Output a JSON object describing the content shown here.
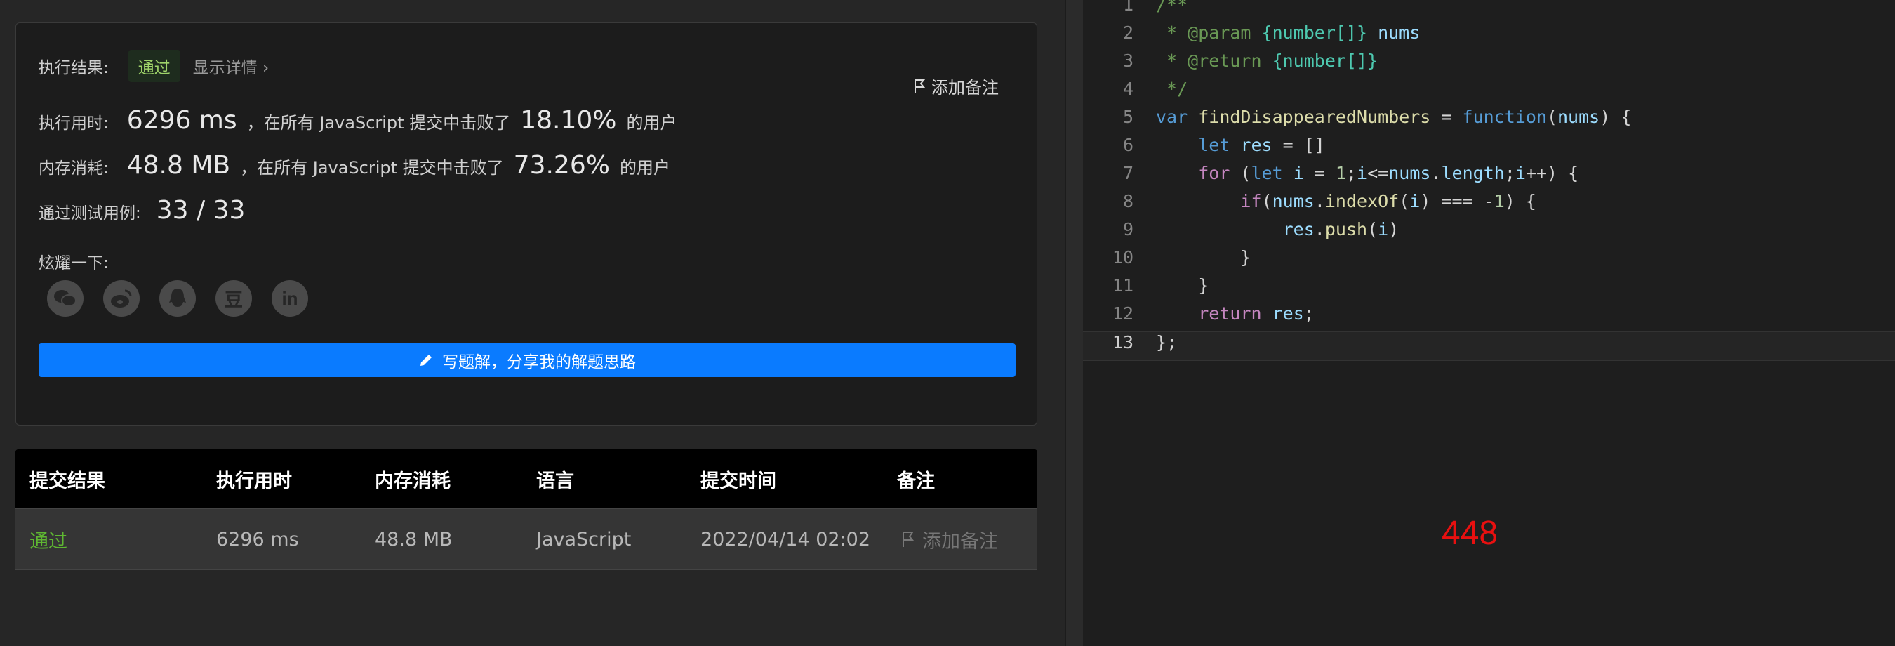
{
  "result": {
    "exec_result_label": "执行结果:",
    "status": "通过",
    "show_details": "显示详情 ›",
    "add_note": "添加备注",
    "runtime_label": "执行用时:",
    "runtime_value": "6296 ms",
    "runtime_text": "，在所有 JavaScript 提交中击败了",
    "runtime_percent": "18.10%",
    "runtime_suffix": "的用户",
    "memory_label": "内存消耗:",
    "memory_value": "48.8 MB",
    "memory_text": "，在所有 JavaScript 提交中击败了",
    "memory_percent": "73.26%",
    "memory_suffix": "的用户",
    "testcases_label": "通过测试用例:",
    "testcases_value": "33 / 33",
    "share_label": "炫耀一下:",
    "share_icons": [
      "wechat-icon",
      "weibo-icon",
      "qq-icon",
      "douban-icon",
      "linkedin-icon"
    ],
    "douban_glyph": "豆",
    "linkedin_glyph": "in",
    "write_solution": "写题解，分享我的解题思路"
  },
  "submissions": {
    "headers": [
      "提交结果",
      "执行用时",
      "内存消耗",
      "语言",
      "提交时间",
      "备注"
    ],
    "row": {
      "result": "通过",
      "runtime": "6296 ms",
      "memory": "48.8 MB",
      "language": "JavaScript",
      "time": "2022/04/14 02:02",
      "note": "添加备注"
    }
  },
  "editor": {
    "line_numbers": [
      "1",
      "2",
      "3",
      "4",
      "5",
      "6",
      "7",
      "8",
      "9",
      "10",
      "11",
      "12",
      "13"
    ],
    "current_line": 13
  },
  "annotation": {
    "problem_number": "448",
    "color": "#e81010"
  },
  "colors": {
    "accent": "#0a7bff",
    "pass": "#9fd36a"
  }
}
